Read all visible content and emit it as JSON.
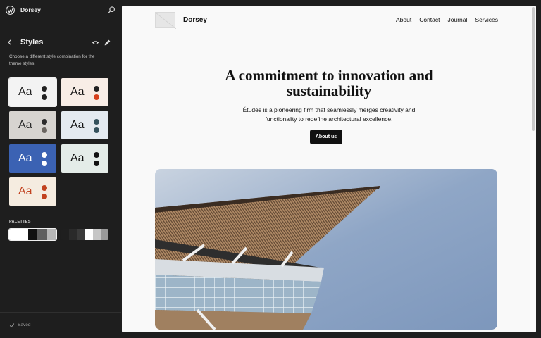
{
  "app": {
    "site_name": "Dorsey",
    "icons": {
      "logo": "wordpress-logo-icon",
      "search": "search-icon",
      "back": "chevron-left-icon",
      "preview": "eye-icon",
      "edit": "pencil-icon",
      "saved": "check-icon"
    }
  },
  "sidebar": {
    "title": "Styles",
    "description": "Choose a different style combination for the theme styles.",
    "variations": [
      {
        "label": "Aa",
        "bg": "#f3f3f3",
        "text": "#222222",
        "dot1": "#222222",
        "dot2": "#222222"
      },
      {
        "label": "Aa",
        "bg": "#f8ede6",
        "text": "#111111",
        "dot1": "#222222",
        "dot2": "#d6401d"
      },
      {
        "label": "Aa",
        "bg": "#d7d4d0",
        "text": "#2b2b2b",
        "dot1": "#2b2b2b",
        "dot2": "#6a6560"
      },
      {
        "label": "Aa",
        "bg": "#e4eaf0",
        "text": "#111111",
        "dot1": "#35525d",
        "dot2": "#35525d"
      },
      {
        "label": "Aa",
        "bg": "#3b62b3",
        "text": "#ffffff",
        "dot1": "#ffffff",
        "dot2": "#ffffff"
      },
      {
        "label": "Aa",
        "bg": "#e4ece8",
        "text": "#111111",
        "dot1": "#111111",
        "dot2": "#111111"
      },
      {
        "label": "Aa",
        "bg": "#f5ece0",
        "text": "#c2421f",
        "dot1": "#c2421f",
        "dot2": "#c2421f"
      }
    ],
    "palettes_label": "PALETTES",
    "palettes": [
      {
        "swatches": [
          "#ffffff",
          "#ffffff",
          "#111111",
          "#5f5f5f",
          "#b7b7b7"
        ]
      },
      {
        "swatches": [
          "#1f1f1f",
          "#2a2a2a",
          "#3a3a3a",
          "#ffffff",
          "#c6c6c6",
          "#9a9a9a"
        ]
      }
    ],
    "saved_label": "Saved"
  },
  "canvas": {
    "site_title": "Dorsey",
    "nav": [
      "About",
      "Contact",
      "Journal",
      "Services"
    ],
    "hero_title_line1": "A commitment to innovation and",
    "hero_title_line2": "sustainability",
    "hero_subtitle": "Études is a pioneering firm that seamlessly merges creativity and functionality to redefine architectural excellence.",
    "cta_label": "About us"
  }
}
